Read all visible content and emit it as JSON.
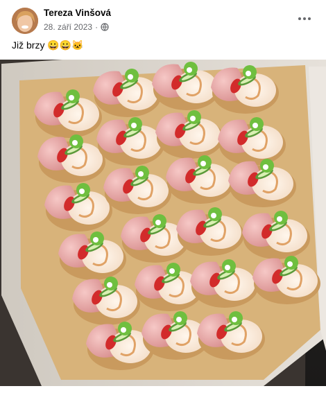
{
  "post": {
    "author": "Tereza Vinšová",
    "date": "28. září 2023",
    "separator": "·",
    "privacy_icon": "globe-icon",
    "more_icon": "more-dots-icon",
    "caption": "Již brzy 😀😀🐱"
  },
  "colors": {
    "name_text": "#050505",
    "meta_text": "#65676b"
  }
}
